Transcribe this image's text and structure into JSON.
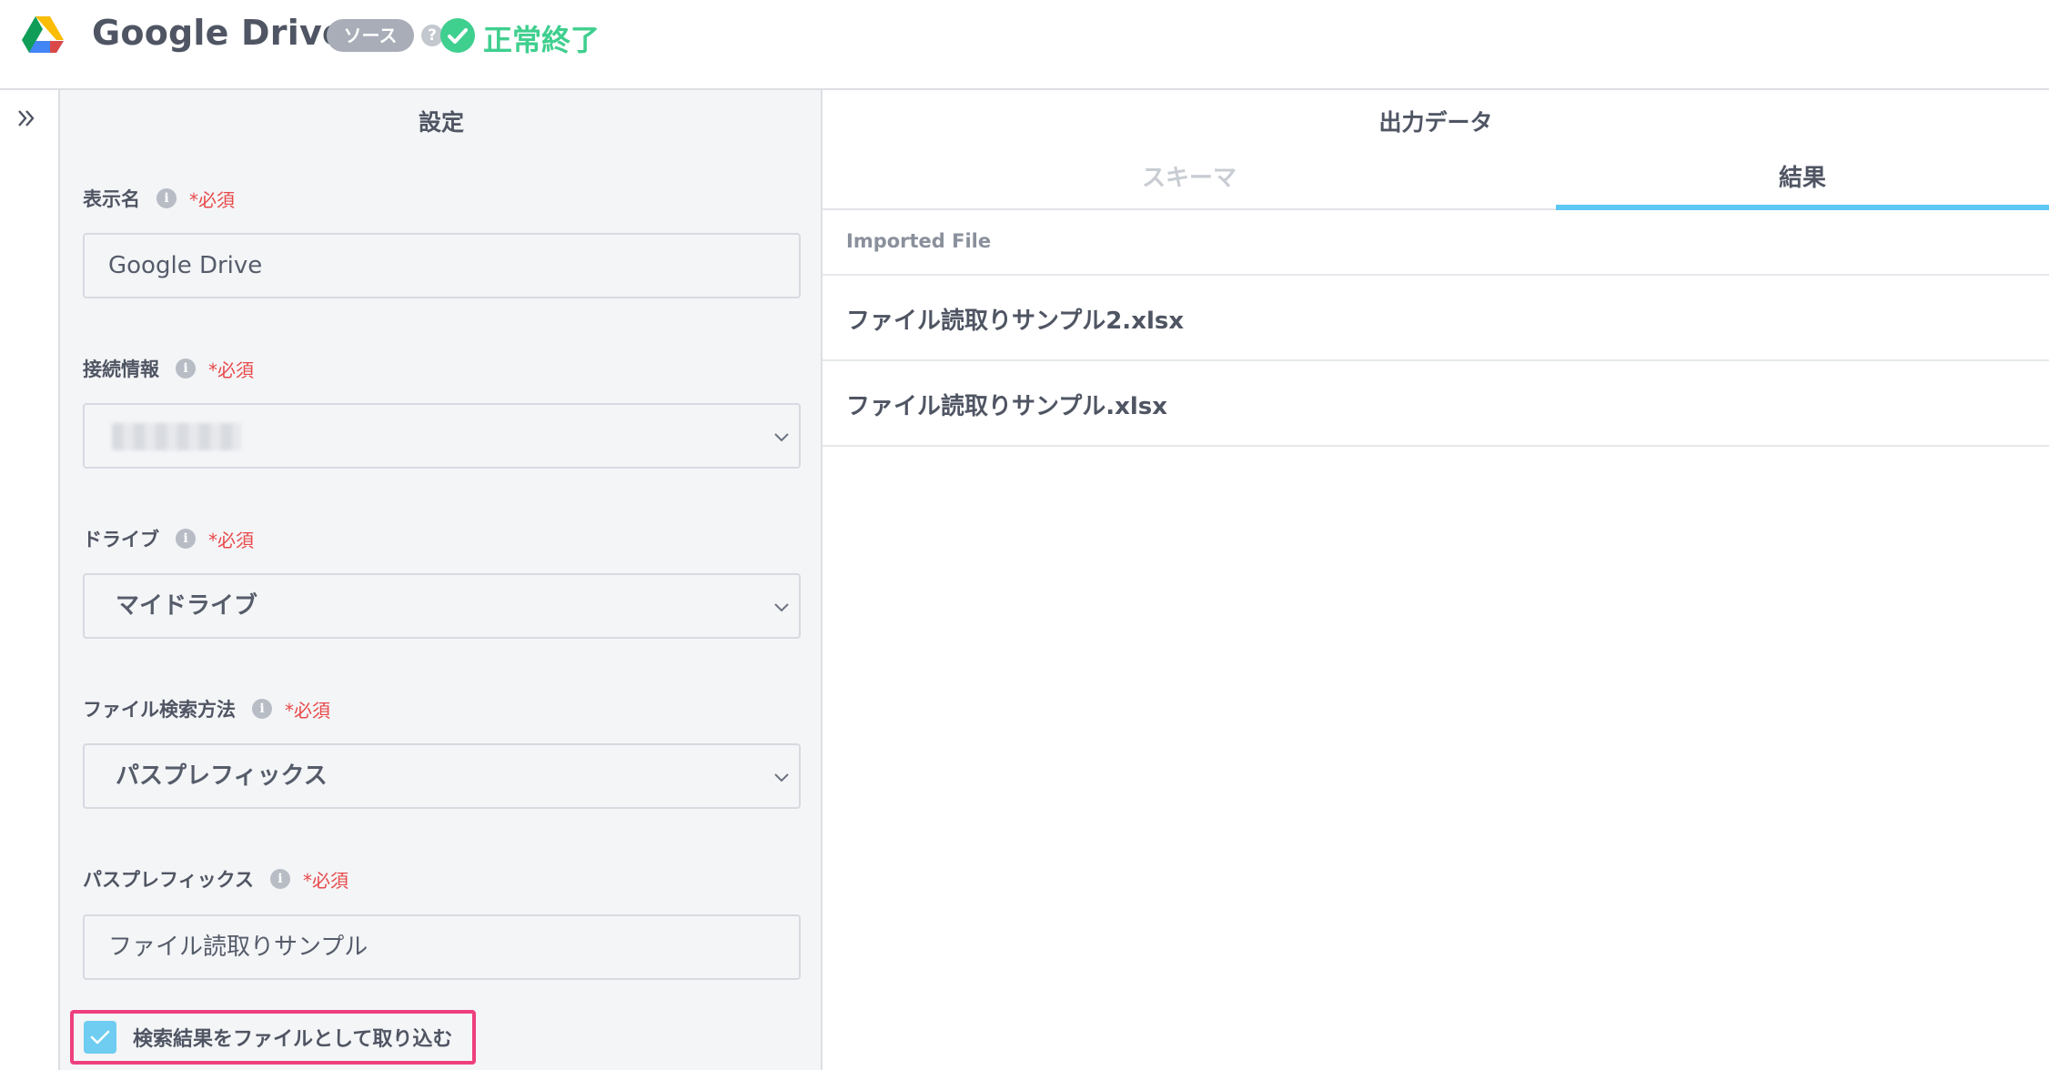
{
  "header": {
    "app_title": "Google Drive",
    "badge": "ソース",
    "help": "?",
    "status": "正常終了",
    "colors": {
      "status": "#3fcf8e",
      "badge": "#a8adb8"
    }
  },
  "settings": {
    "title": "設定",
    "info_glyph": "i",
    "required_text": "*必須",
    "display_name": {
      "label": "表示名",
      "value": "Google Drive"
    },
    "connection": {
      "label": "接続情報",
      "value": ""
    },
    "drive": {
      "label": "ドライブ",
      "value": "マイドライブ"
    },
    "search_method": {
      "label": "ファイル検索方法",
      "value": "パスプレフィックス"
    },
    "path_prefix": {
      "label": "パスプレフィックス",
      "value": "ファイル読取りサンプル"
    },
    "import_checkbox": {
      "label": "検索結果をファイルとして取り込む",
      "checked": true
    }
  },
  "output": {
    "title": "出力データ",
    "tabs": [
      {
        "label": "スキーマ",
        "active": false
      },
      {
        "label": "結果",
        "active": true
      }
    ],
    "column_header": "Imported File",
    "rows": [
      "ファイル読取りサンプル2.xlsx",
      "ファイル読取りサンプル.xlsx"
    ]
  }
}
